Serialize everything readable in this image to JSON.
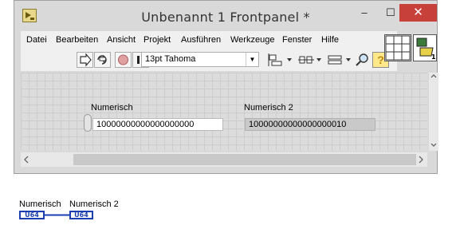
{
  "window": {
    "title": "Unbenannt 1 Frontpanel *",
    "controls": {
      "minimize": "–",
      "maximize": "☐",
      "close": "✕"
    }
  },
  "menubar": {
    "items": [
      "Datei",
      "Bearbeiten",
      "Ansicht",
      "Projekt",
      "Ausführen",
      "Werkzeuge",
      "Fenster",
      "Hilfe"
    ]
  },
  "toolbar": {
    "font_dropdown": "13pt Tahoma",
    "help_glyph": "?"
  },
  "front_panel": {
    "control": {
      "label": "Numerisch",
      "value": "10000000000000000000"
    },
    "indicator": {
      "label": "Numerisch 2",
      "value": "10000000000000000010"
    }
  },
  "block_diagram": {
    "terminal1": {
      "label": "Numerisch",
      "type": "U64"
    },
    "terminal2": {
      "label": "Numerisch 2",
      "type": "U64"
    }
  },
  "colors": {
    "close_button": "#c7403a",
    "terminal_blue": "#1b3fb0"
  }
}
